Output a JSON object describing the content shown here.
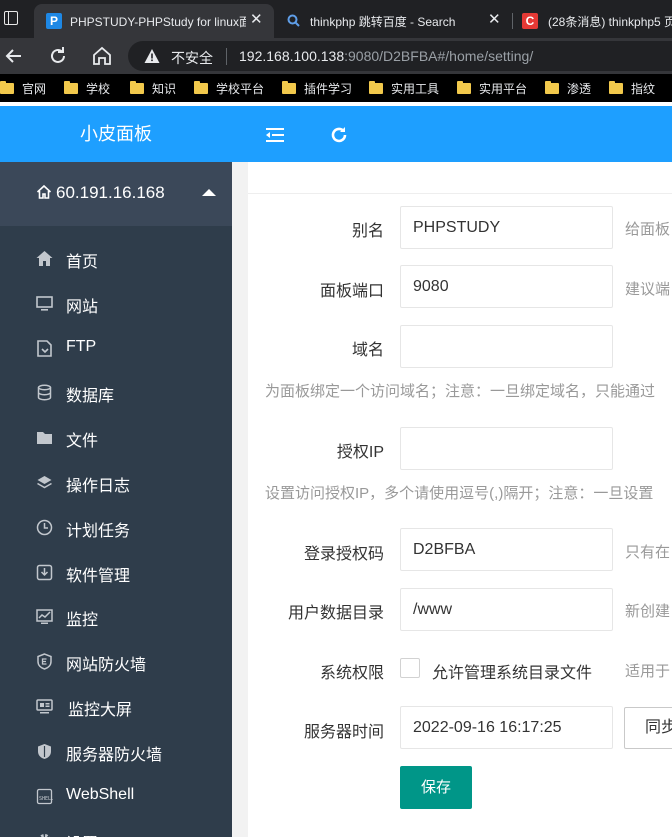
{
  "browser": {
    "tabs": [
      {
        "title": "PHPSTUDY-PHPStudy for linux面",
        "favicon": "P",
        "favicon_color": "#1e88e5",
        "active": true
      },
      {
        "title": "thinkphp 跳转百度 - Search",
        "favicon": "search-icon",
        "favicon_color": "#5f9ee8",
        "active": false
      },
      {
        "title": "(28条消息) thinkphp5 页",
        "favicon": "C",
        "favicon_color": "#e53935",
        "active": false
      }
    ],
    "tab_close_glyph": "✕",
    "insecure_label": "不安全",
    "url_host": "192.168.100.138",
    "url_rest": ":9080/D2BFBA#/home/setting/",
    "bookmarks": [
      "官网",
      "学校",
      "知识",
      "学校平台",
      "插件学习",
      "实用工具",
      "实用平台",
      "渗透",
      "指纹"
    ]
  },
  "app": {
    "brand": "小皮面板",
    "server_ip": "60.191.16.168",
    "menu": [
      {
        "label": "首页",
        "icon": "home-icon"
      },
      {
        "label": "网站",
        "icon": "monitor-icon"
      },
      {
        "label": "FTP",
        "icon": "ftp-icon"
      },
      {
        "label": "数据库",
        "icon": "database-icon"
      },
      {
        "label": "文件",
        "icon": "folder-icon"
      },
      {
        "label": "操作日志",
        "icon": "layers-icon"
      },
      {
        "label": "计划任务",
        "icon": "clock-icon"
      },
      {
        "label": "软件管理",
        "icon": "download-box-icon"
      },
      {
        "label": "监控",
        "icon": "chart-monitor-icon"
      },
      {
        "label": "网站防火墙",
        "icon": "shield-e-icon"
      },
      {
        "label": "监控大屏",
        "icon": "dashboard-screen-icon"
      },
      {
        "label": "服务器防火墙",
        "icon": "shield-icon"
      },
      {
        "label": "WebShell",
        "icon": "terminal-icon"
      },
      {
        "label": "设置",
        "icon": "gear-icon"
      }
    ],
    "colors": {
      "accent": "#1e9fff",
      "sidebar": "#2f3d4b",
      "save": "#009688"
    }
  },
  "form": {
    "alias": {
      "label": "别名",
      "value": "PHPSTUDY",
      "hint": "给面板"
    },
    "port": {
      "label": "面板端口",
      "value": "9080",
      "hint": "建议端"
    },
    "domain": {
      "label": "域名",
      "value": "",
      "tip": "为面板绑定一个访问域名；注意：一旦绑定域名，只能通过"
    },
    "auth_ip": {
      "label": "授权IP",
      "value": "",
      "tip": "设置访问授权IP，多个请使用逗号(,)隔开；注意：一旦设置"
    },
    "auth_code": {
      "label": "登录授权码",
      "value": "D2BFBA",
      "hint": "只有在"
    },
    "data_dir": {
      "label": "用户数据目录",
      "value": "/www",
      "hint": "新创建"
    },
    "permission": {
      "label": "系统权限",
      "checkbox_label": "允许管理系统目录文件",
      "checked": false,
      "hint": "适用于"
    },
    "server_time": {
      "label": "服务器时间",
      "value": "2022-09-16 16:17:25",
      "sync_label": "同步"
    },
    "save_label": "保存"
  }
}
